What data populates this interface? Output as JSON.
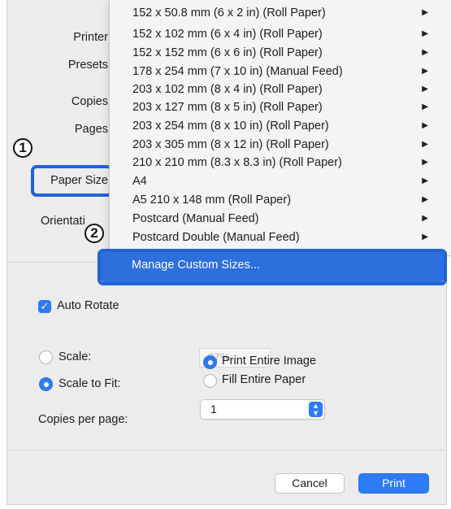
{
  "left_labels": {
    "printer": "Printer",
    "presets": "Presets",
    "copies": "Copies",
    "pages": "Pages",
    "paper_size": "Paper Size",
    "orientation": "Orientati"
  },
  "menu_items": [
    "152 x 50.8 mm (6 x 2 in) (Roll Paper)",
    "152 x 102 mm (6 x 4 in) (Roll Paper)",
    "152 x 152 mm (6 x 6 in) (Roll Paper)",
    "178 x 254 mm (7 x 10 in) (Manual Feed)",
    "203 x 102 mm (8 x 4 in) (Roll Paper)",
    "203 x 127 mm (8 x 5 in) (Roll Paper)",
    "203 x 254 mm (8 x 10 in) (Roll Paper)",
    "203 x 305 mm (8 x 12 in) (Roll Paper)",
    "210 x 210 mm (8.3 x 8.3 in) (Roll Paper)",
    "A4",
    "A5 210 x 148 mm (Roll Paper)",
    "Postcard (Manual Feed)",
    "Postcard Double (Manual Feed)"
  ],
  "submenu_arrow": "▶",
  "manage_custom_sizes": "Manage Custom Sizes...",
  "callouts": {
    "one": "1",
    "two": "2"
  },
  "auto_rotate": {
    "label": "Auto Rotate",
    "checked": true
  },
  "scale": {
    "label": "Scale:",
    "value": "97%"
  },
  "scale_to_fit": {
    "label": "Scale to Fit:"
  },
  "fit_options": {
    "print_entire_image": "Print Entire Image",
    "fill_entire_paper": "Fill Entire Paper"
  },
  "copies_per_page": {
    "label": "Copies per page:",
    "value": "1"
  },
  "buttons": {
    "cancel": "Cancel",
    "print": "Print"
  },
  "colors": {
    "accent": "#2d7cf6",
    "highlight": "#2d6fdc",
    "callout": "#1f63d6"
  }
}
